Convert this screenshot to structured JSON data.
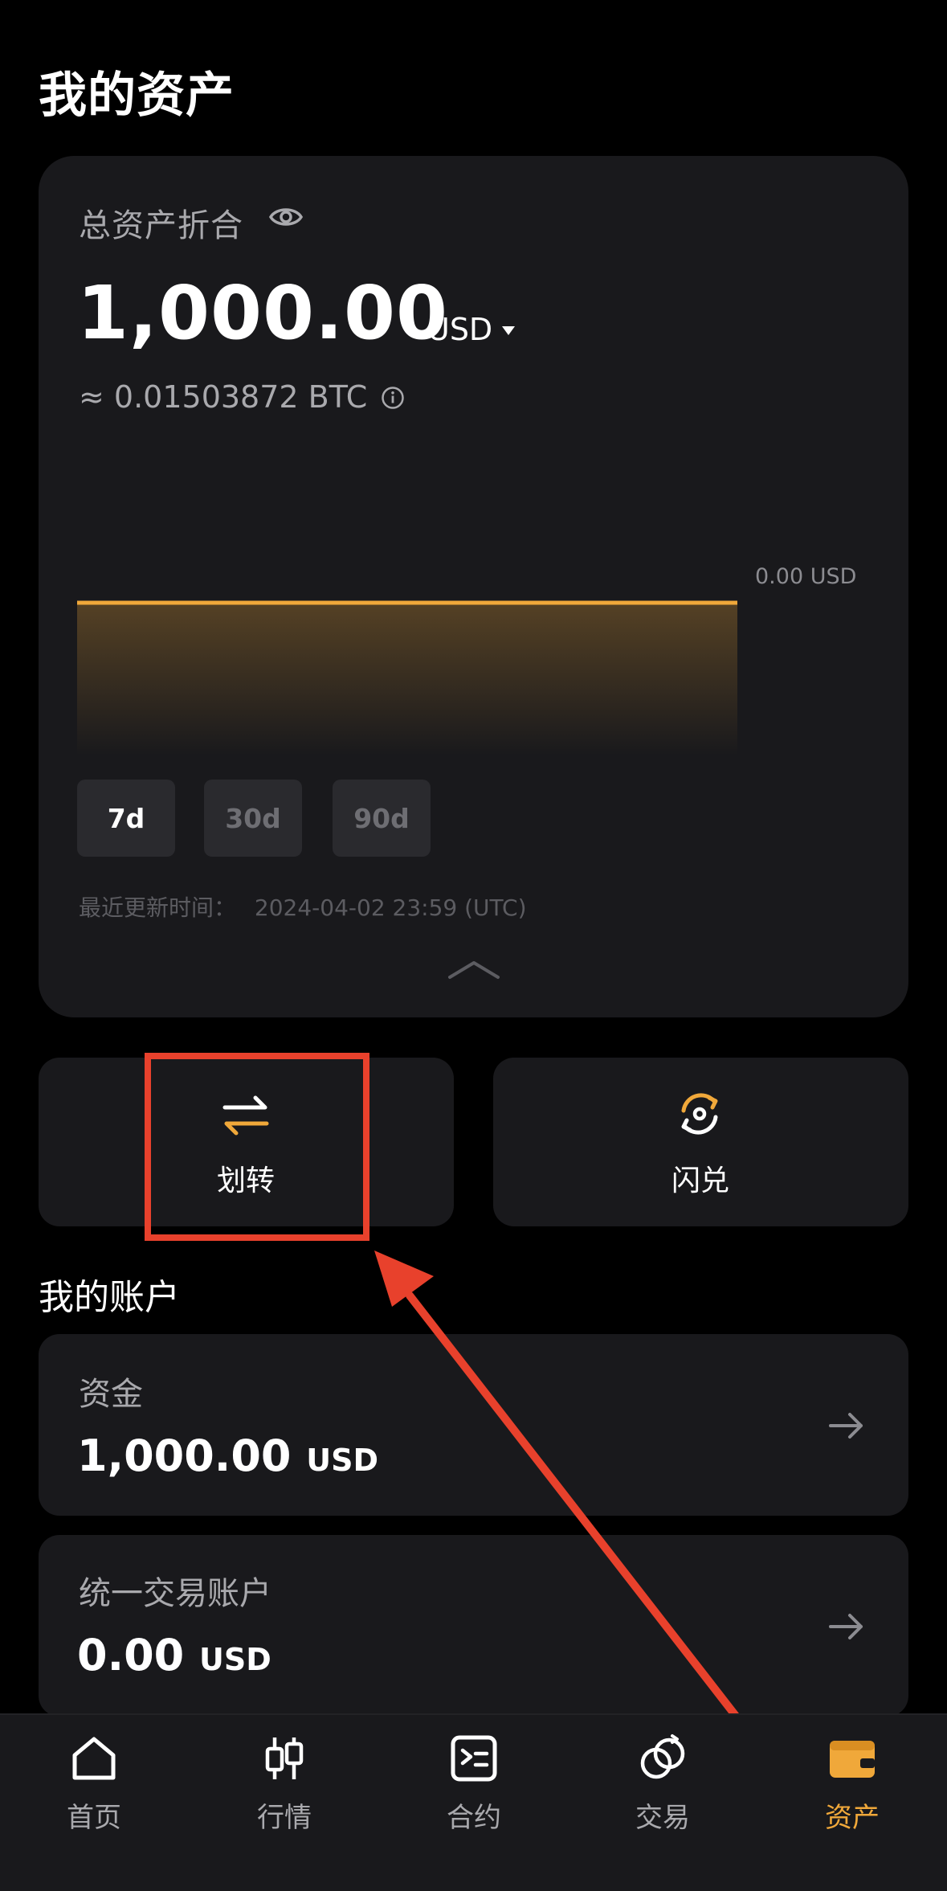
{
  "page_title": "我的资产",
  "summary": {
    "total_label": "总资产折合",
    "balance": "1,000.00",
    "currency": "USD",
    "btc_equiv": "≈ 0.01503872 BTC",
    "chart_value_label": "0.00 USD",
    "periods": [
      "7d",
      "30d",
      "90d"
    ],
    "active_period": "7d",
    "updated_label": "最近更新时间：",
    "updated_time": "2024-04-02 23:59 (UTC)"
  },
  "actions": {
    "transfer_label": "划转",
    "swap_label": "闪兑"
  },
  "accounts_title": "我的账户",
  "accounts": [
    {
      "name": "资金",
      "value": "1,000.00",
      "unit": "USD"
    },
    {
      "name": "统一交易账户",
      "value": "0.00",
      "unit": "USD"
    }
  ],
  "tabs": [
    {
      "label": "首页",
      "icon": "home-icon"
    },
    {
      "label": "行情",
      "icon": "candlestick-icon"
    },
    {
      "label": "合约",
      "icon": "contract-icon"
    },
    {
      "label": "交易",
      "icon": "trade-icon"
    },
    {
      "label": "资产",
      "icon": "wallet-icon"
    }
  ],
  "active_tab": "资产",
  "colors": {
    "accent": "#f0a83a",
    "background": "#000000",
    "card": "#19191c",
    "annotation": "#e8412c"
  }
}
